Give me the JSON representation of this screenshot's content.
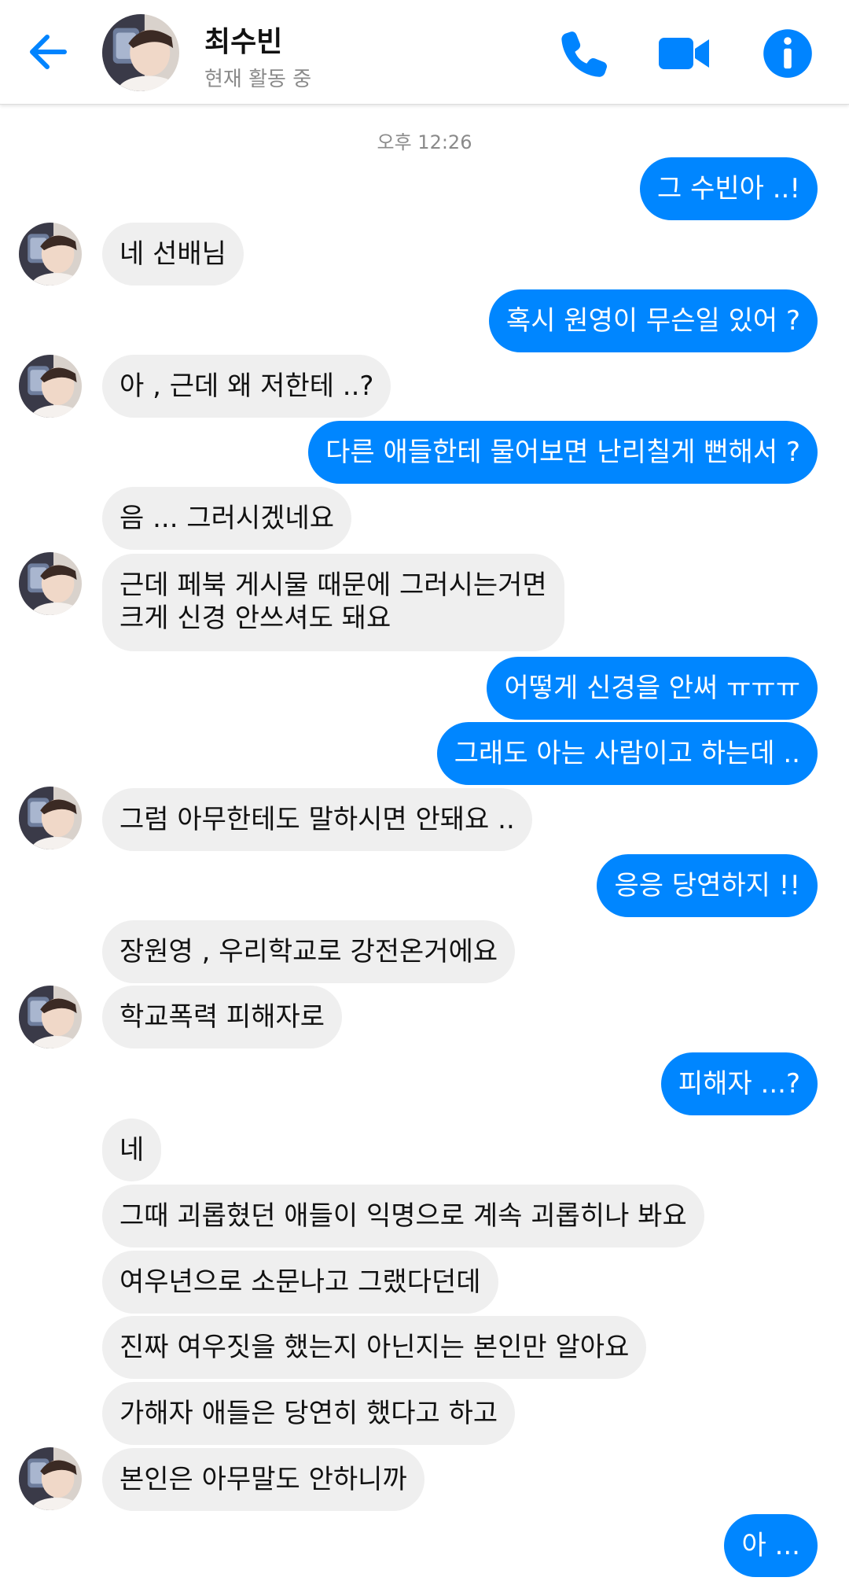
{
  "header": {
    "name": "최수빈",
    "status": "현재 활동 중",
    "icons": {
      "back": "arrow-left-icon",
      "call": "phone-icon",
      "video": "video-camera-icon",
      "info": "info-icon"
    },
    "accent_color": "#0084ff"
  },
  "thread": {
    "timestamp": "오후 12:26",
    "colors": {
      "incoming_bubble": "#efefef",
      "outgoing_bubble": "#0086ff"
    },
    "messages": [
      {
        "from": "me",
        "text": "그 수빈아 ..!"
      },
      {
        "from": "them",
        "text": "네 선배님"
      },
      {
        "from": "me",
        "text": "혹시 원영이 무슨일 있어 ?"
      },
      {
        "from": "them",
        "text": "아 , 근데 왜 저한테 ..?"
      },
      {
        "from": "me",
        "text": "다른 애들한테 물어보면 난리칠게 뻔해서 ?"
      },
      {
        "from": "them",
        "text": "음 ... 그러시겠네요"
      },
      {
        "from": "them",
        "text": "근데 페북 게시물 때문에 그러시는거면\n크게 신경 안쓰셔도 돼요"
      },
      {
        "from": "me",
        "text": "어떻게 신경을 안써 ㅠㅠㅠ"
      },
      {
        "from": "me",
        "text": "그래도 아는 사람이고 하는데 .."
      },
      {
        "from": "them",
        "text": "그럼 아무한테도 말하시면 안돼요 .."
      },
      {
        "from": "me",
        "text": "응응 당연하지 !!"
      },
      {
        "from": "them",
        "text": "장원영 , 우리학교로 강전온거에요"
      },
      {
        "from": "them",
        "text": "학교폭력 피해자로"
      },
      {
        "from": "me",
        "text": "피해자 ...?"
      },
      {
        "from": "them",
        "text": "네"
      },
      {
        "from": "them",
        "text": "그때 괴롭혔던 애들이 익명으로 계속 괴롭히나 봐요"
      },
      {
        "from": "them",
        "text": "여우년으로 소문나고 그랬다던데"
      },
      {
        "from": "them",
        "text": "진짜 여우짓을 했는지 아닌지는 본인만 알아요"
      },
      {
        "from": "them",
        "text": "가해자 애들은 당연히 했다고 하고"
      },
      {
        "from": "them",
        "text": "본인은 아무말도 안하니까"
      },
      {
        "from": "me",
        "text": "아 ..."
      }
    ]
  }
}
